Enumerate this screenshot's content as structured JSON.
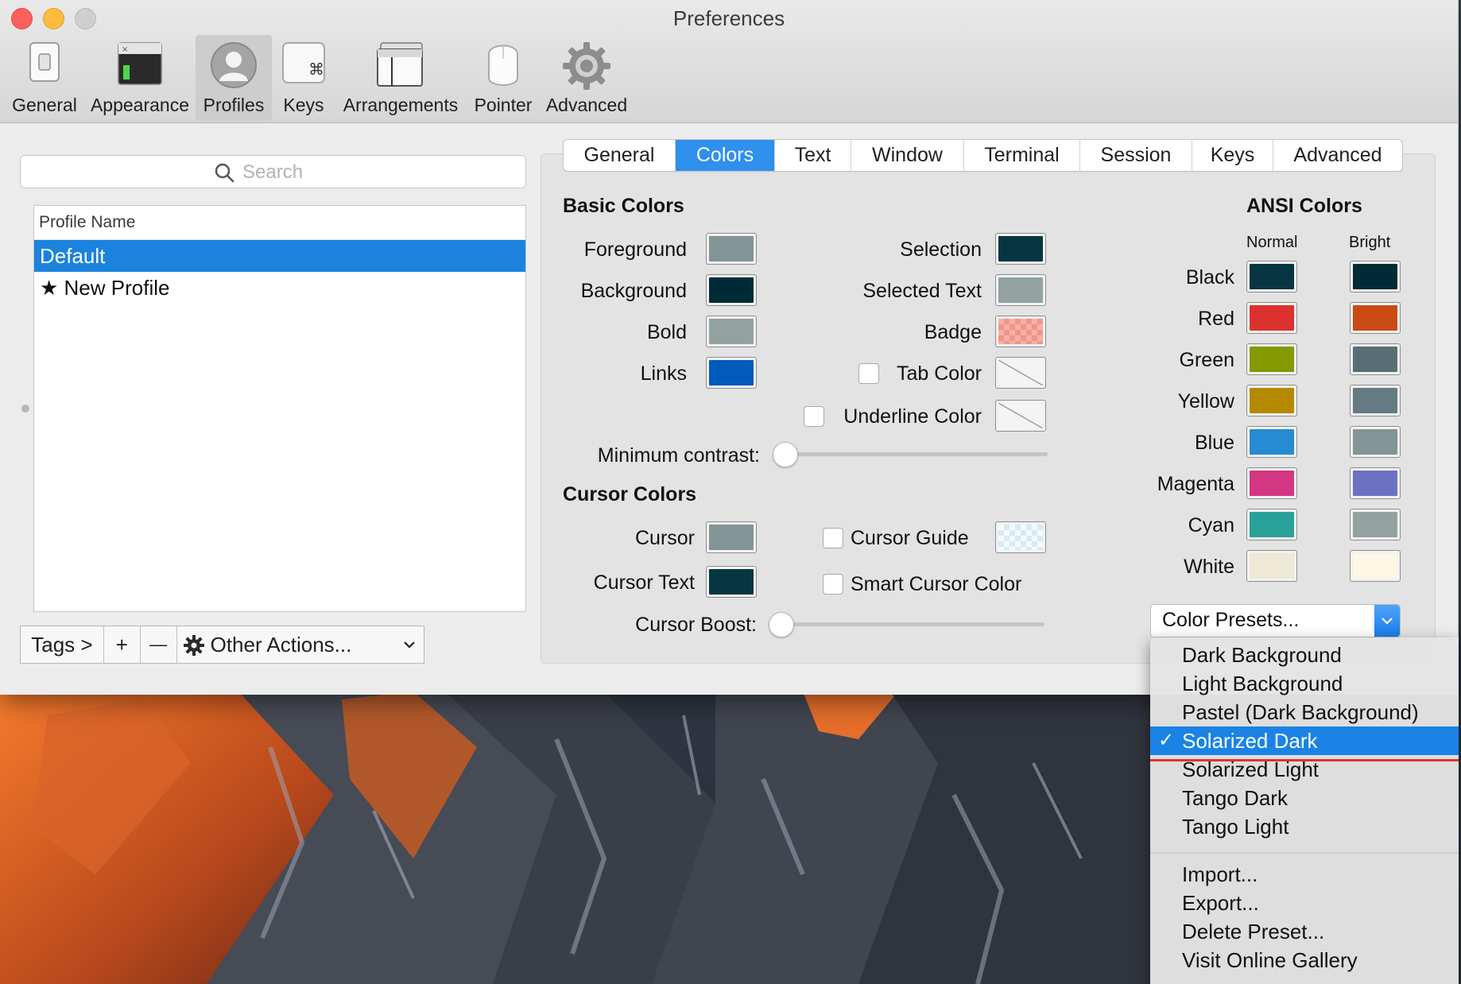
{
  "window": {
    "title": "Preferences"
  },
  "toolbar": {
    "items": [
      {
        "label": "General",
        "icon": "switch-icon"
      },
      {
        "label": "Appearance",
        "icon": "terminal-window-icon"
      },
      {
        "label": "Profiles",
        "icon": "user-silhouette-icon",
        "selected": true
      },
      {
        "label": "Keys",
        "icon": "command-key-icon"
      },
      {
        "label": "Arrangements",
        "icon": "window-stack-icon"
      },
      {
        "label": "Pointer",
        "icon": "mouse-icon"
      },
      {
        "label": "Advanced",
        "icon": "gear-icon"
      }
    ]
  },
  "search": {
    "placeholder": "Search"
  },
  "profiles": {
    "header": "Profile Name",
    "rows": [
      "Default",
      "★ New Profile"
    ],
    "selected": "Default"
  },
  "bottom_bar": {
    "tags": "Tags >",
    "add": "+",
    "remove": "—",
    "other_actions": "Other Actions..."
  },
  "tabs": [
    "General",
    "Colors",
    "Text",
    "Window",
    "Terminal",
    "Session",
    "Keys",
    "Advanced"
  ],
  "active_tab": "Colors",
  "basic_colors": {
    "title": "Basic Colors",
    "left": [
      {
        "label": "Foreground",
        "color": "#839496"
      },
      {
        "label": "Background",
        "color": "#002b36"
      },
      {
        "label": "Bold",
        "color": "#93a1a1"
      },
      {
        "label": "Links",
        "color": "#005bbb"
      }
    ],
    "right": [
      {
        "label": "Selection",
        "color": "#073642"
      },
      {
        "label": "Selected Text",
        "color": "#93a1a1"
      },
      {
        "label": "Badge",
        "color": "#f4877c"
      },
      {
        "label": "Tab Color",
        "color": "none",
        "checkbox": false
      },
      {
        "label": "Underline Color",
        "color": "none",
        "checkbox": false
      }
    ],
    "min_contrast_label": "Minimum contrast:",
    "min_contrast_value": 0
  },
  "cursor_colors": {
    "title": "Cursor Colors",
    "cursor": {
      "label": "Cursor",
      "color": "#839496"
    },
    "cursor_text": {
      "label": "Cursor Text",
      "color": "#073642"
    },
    "cursor_guide": {
      "label": "Cursor Guide",
      "checkbox": false,
      "color": "#dfeef6"
    },
    "smart_cursor": {
      "label": "Smart Cursor Color",
      "checkbox": false
    },
    "boost_label": "Cursor Boost:",
    "boost_value": 0
  },
  "ansi": {
    "title": "ANSI Colors",
    "col_normal": "Normal",
    "col_bright": "Bright",
    "rows": [
      {
        "label": "Black",
        "normal": "#073642",
        "bright": "#002b36"
      },
      {
        "label": "Red",
        "normal": "#dc322f",
        "bright": "#cb4b16"
      },
      {
        "label": "Green",
        "normal": "#859900",
        "bright": "#586e75"
      },
      {
        "label": "Yellow",
        "normal": "#b58900",
        "bright": "#657b83"
      },
      {
        "label": "Blue",
        "normal": "#268bd2",
        "bright": "#839496"
      },
      {
        "label": "Magenta",
        "normal": "#d33682",
        "bright": "#6c71c4"
      },
      {
        "label": "Cyan",
        "normal": "#2aa198",
        "bright": "#93a1a1"
      },
      {
        "label": "White",
        "normal": "#eee8d5",
        "bright": "#fdf6e3"
      }
    ]
  },
  "presets": {
    "button_label": "Color Presets...",
    "menu": [
      "Dark Background",
      "Light Background",
      "Pastel (Dark Background)",
      "Solarized Dark",
      "Solarized Light",
      "Tango Dark",
      "Tango Light"
    ],
    "actions": [
      "Import...",
      "Export...",
      "Delete Preset...",
      "Visit Online Gallery"
    ],
    "checked": "Solarized Dark",
    "check_glyph": "✓"
  }
}
